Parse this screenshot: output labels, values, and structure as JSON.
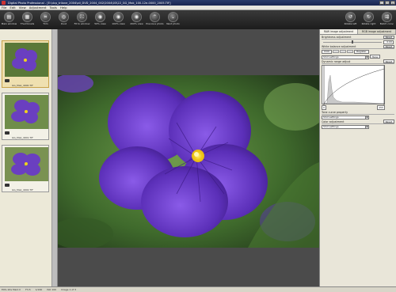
{
  "window": {
    "title": "Digital Photo Professional - [E:\\dcp_trilane_2004\\all_DVD_2004_002\\2004\\03\\22_GG_Mak_100-12e-0000_2005.TIF]",
    "min": "_",
    "max": "□",
    "close": "×"
  },
  "menu": [
    "File",
    "Edit",
    "View",
    "Adjustment",
    "Tools",
    "Help"
  ],
  "toolbar": {
    "left": [
      {
        "label": "Main window",
        "icon": "main-window-icon",
        "glyph": "▤"
      },
      {
        "label": "Thumbnails",
        "icon": "thumbnails-icon",
        "glyph": "▦"
      },
      {
        "label": "Trim",
        "icon": "trim-icon",
        "glyph": "⌗"
      },
      {
        "label": "Dust",
        "icon": "dust-icon",
        "glyph": "◎"
      },
      {
        "label": "Fit to window",
        "icon": "fit-window-icon",
        "glyph": "⛶"
      },
      {
        "label": "50% view",
        "icon": "zoom-50-icon",
        "glyph": "◉"
      },
      {
        "label": "100% view",
        "icon": "zoom-100-icon",
        "glyph": "◉"
      },
      {
        "label": "200% view",
        "icon": "zoom-200-icon",
        "glyph": "◉"
      },
      {
        "label": "Previous photo",
        "icon": "previous-icon",
        "glyph": "⌃"
      },
      {
        "label": "Next photo",
        "icon": "next-icon",
        "glyph": "⌄"
      }
    ],
    "right": [
      {
        "label": "Rotate left",
        "icon": "rotate-left-icon",
        "glyph": "↺"
      },
      {
        "label": "Rotate right",
        "icon": "rotate-right-icon",
        "glyph": "↻"
      },
      {
        "label": "Batch conv.",
        "icon": "batch-convert-icon",
        "glyph": "⇶"
      }
    ]
  },
  "thumbnails": [
    {
      "name": "GG_Mak_4000.TIF"
    },
    {
      "name": "GG_Mak_4001.TIF"
    },
    {
      "name": "GG_Mak_4002.TIF"
    }
  ],
  "right_panel": {
    "tabs": [
      "RAW image adjustment",
      "RGB image adjustment"
    ],
    "brightness": {
      "label": "Brightness adjustment",
      "reset": "Reset",
      "value": "0.00"
    },
    "white_balance": {
      "label": "White balance adjustment",
      "reset": "Reset",
      "click": "Click",
      "register": "Register",
      "tune": "Tune",
      "preset": "Shot settings"
    },
    "dynamic_range": {
      "label": "Dynamic range adjust",
      "reset": "Reset",
      "min": "0",
      "max": "255"
    },
    "tone_curve": {
      "label": "Tone curve property",
      "preset": "Shot settings"
    },
    "color": {
      "label": "Color adjustment",
      "reset": "Reset",
      "preset": "Shot settings"
    }
  },
  "status": [
    "EOS-1Ds Mark II",
    "F3.5",
    "1/160",
    "ISO 100",
    "Image 1 of 3"
  ]
}
